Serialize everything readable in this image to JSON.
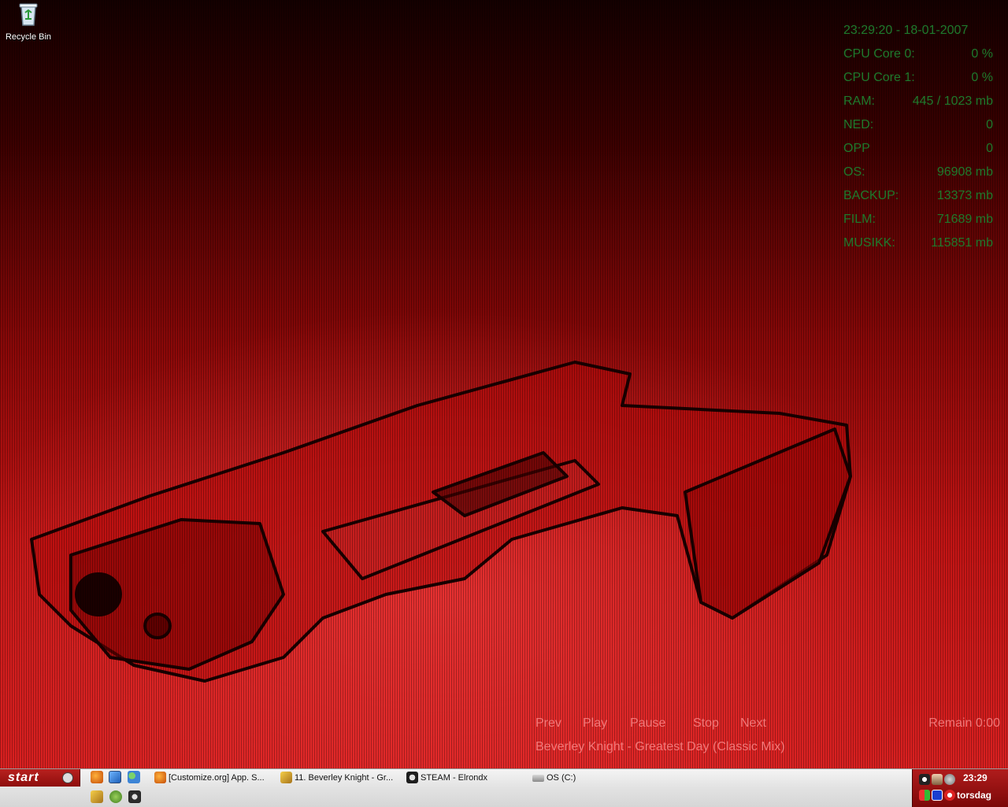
{
  "desktop": {
    "icons": [
      {
        "label": "Recycle Bin",
        "icon": "recycle-bin-icon"
      }
    ]
  },
  "sysmon": {
    "clock": "23:29:20 - 18-01-2007",
    "rows": [
      {
        "label": "CPU Core 0:",
        "value": "0 %"
      },
      {
        "label": "CPU Core 1:",
        "value": "0 %"
      },
      {
        "label": "RAM:",
        "value": "445 / 1023 mb"
      },
      {
        "label": "NED:",
        "value": "0"
      },
      {
        "label": "OPP",
        "value": "0"
      },
      {
        "label": "OS:",
        "value": "96908 mb"
      },
      {
        "label": "BACKUP:",
        "value": "13373 mb"
      },
      {
        "label": "FILM:",
        "value": "71689 mb"
      },
      {
        "label": "MUSIKK:",
        "value": "115851 mb"
      }
    ],
    "color": "#1e7a2c"
  },
  "player": {
    "prev": "Prev",
    "play": "Play",
    "pause": "Pause",
    "stop": "Stop",
    "next": "Next",
    "remain": "Remain 0:00",
    "track": "Beverley Knight - Greatest Day (Classic Mix)"
  },
  "taskbar": {
    "start_label": "start",
    "quicklaunch": [
      "firefox-icon",
      "ie-icon",
      "msn-messenger-icon",
      "winamp-icon",
      "utorrent-icon",
      "steam-icon"
    ],
    "tasks": [
      {
        "label": "[Customize.org] App. S...",
        "icon": "firefox-icon"
      },
      {
        "label": "11. Beverley Knight - Gr...",
        "icon": "winamp-icon"
      },
      {
        "label": "STEAM - Elrondx",
        "icon": "steam-icon"
      },
      {
        "label": "OS (C:)",
        "icon": "drive-icon"
      }
    ]
  },
  "tray": {
    "time": "23:29",
    "day": "torsdag",
    "icons": [
      "steam-tray-icon",
      "user-tray-icon",
      "network-tray-icon",
      "flag-tray-icon",
      "media-tray-icon",
      "antivirus-tray-icon"
    ]
  },
  "colors": {
    "wallpaper": "#c21414",
    "taskbar": "#e2e2e2",
    "start": "#9e1614",
    "tray": "#9a1212"
  }
}
